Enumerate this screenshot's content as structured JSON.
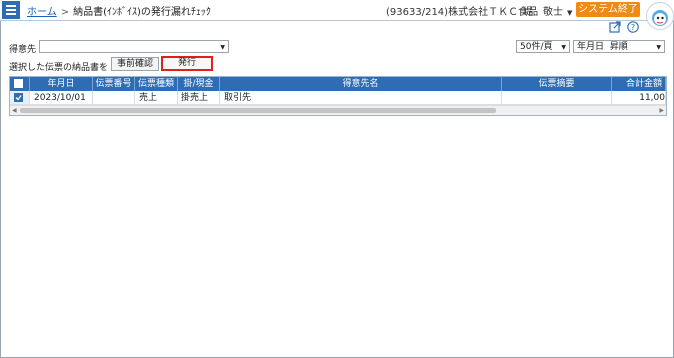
{
  "header": {
    "breadcrumb_home": "ホーム",
    "breadcrumb_sep": ">",
    "page_title": "納品書(ｲﾝﾎﾞｲｽ)の発行漏れﾁｪｯｸ",
    "company": "(93633/214)株式会社ＴＫＣ食品",
    "user_name": "堤　敬士",
    "end_button": "システム終了"
  },
  "filters": {
    "customer_label": "得意先",
    "customer_value": "",
    "per_page": "50件/頁",
    "sort_key": "年月日",
    "sort_order": "昇順"
  },
  "actions": {
    "selected_label": "選択した伝票の納品書を",
    "preview_button": "事前確認",
    "issue_button": "発行"
  },
  "table": {
    "columns": [
      "年月日",
      "伝票番号",
      "伝票種類",
      "掛/現金",
      "得意先名",
      "伝票摘要",
      "合計金額"
    ],
    "rows": [
      {
        "checked": true,
        "date": "2023/10/01",
        "slip_no": "",
        "slip_type": "売上",
        "payment": "掛売上",
        "customer": "取引先",
        "memo": "",
        "total": "11,00"
      }
    ]
  },
  "colors": {
    "accent": "#2e6db4",
    "end_button": "#ef8a14",
    "highlight": "#e02020"
  }
}
